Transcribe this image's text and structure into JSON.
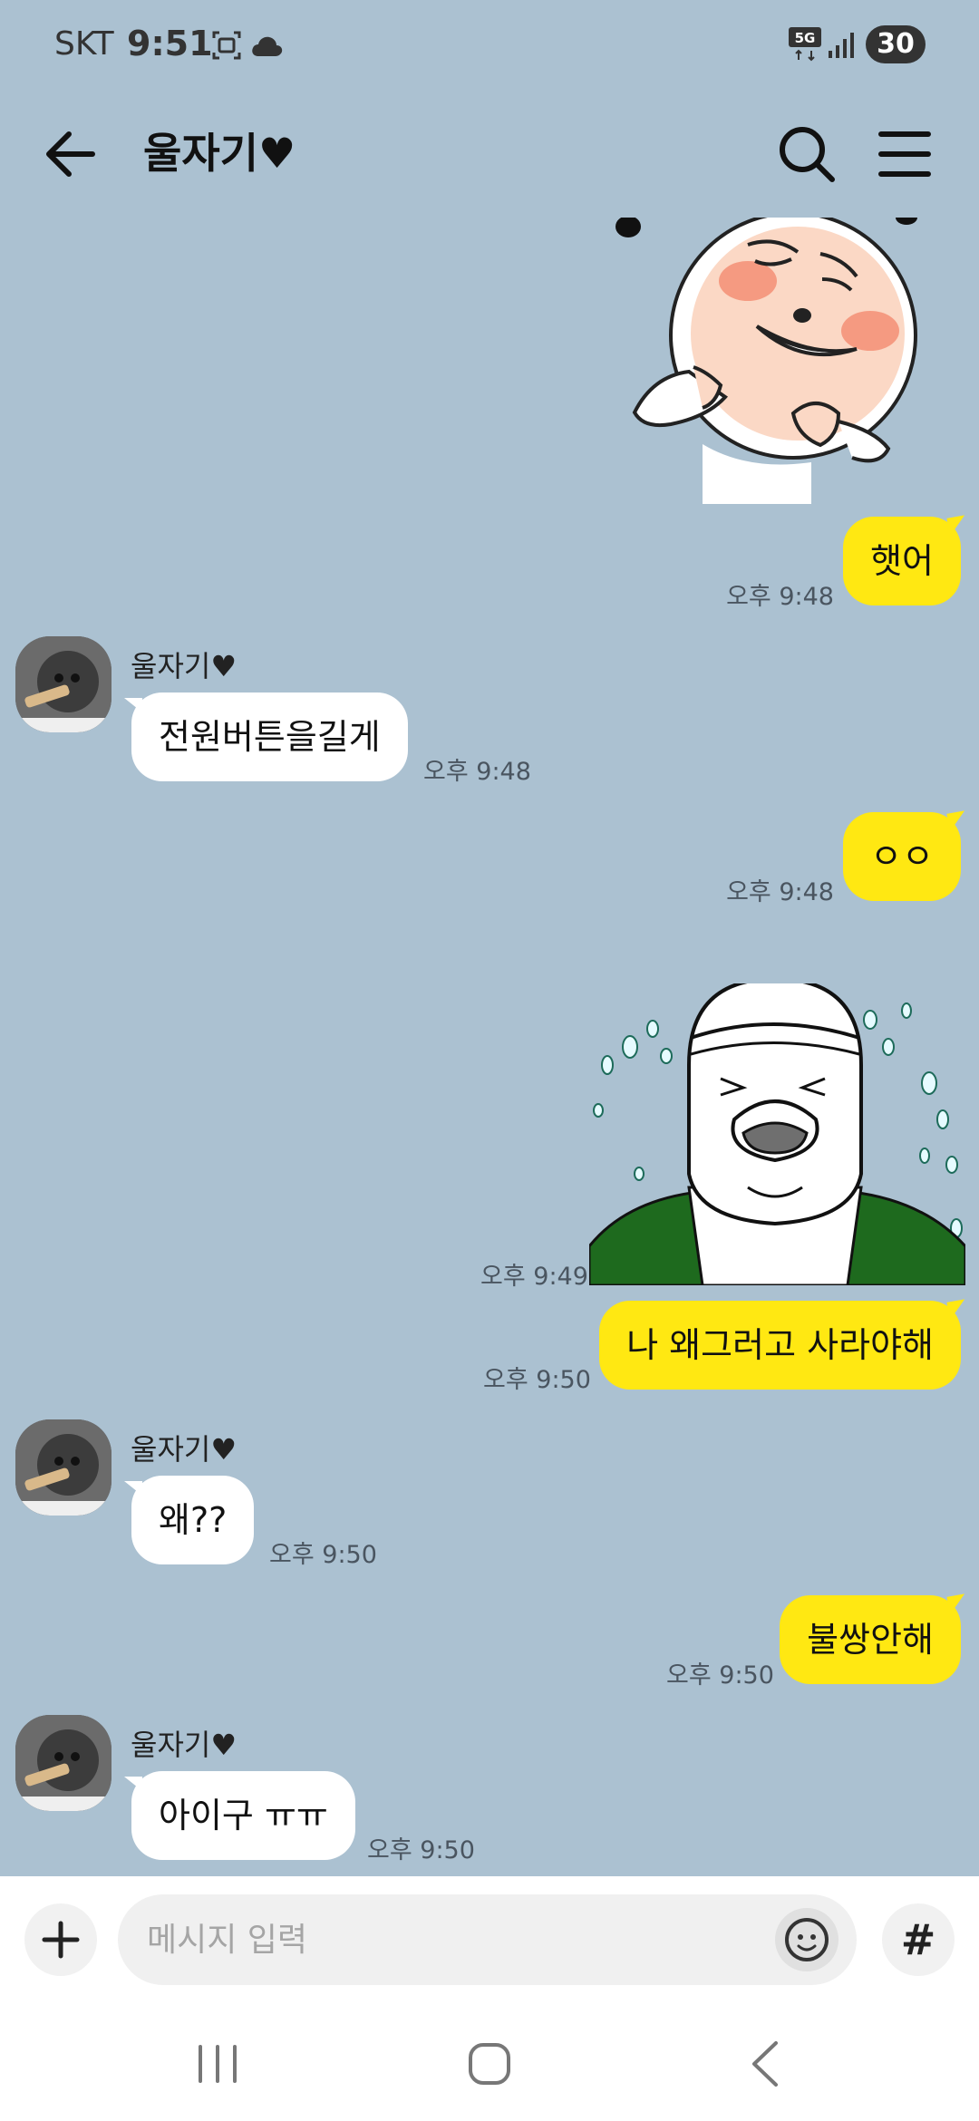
{
  "status_bar": {
    "carrier": "SKT",
    "time": "9:51",
    "network_badge": "5G",
    "battery": "30",
    "icons": [
      "screenshot-icon",
      "cloud-icon",
      "5g-icon",
      "signal-icon",
      "battery-icon"
    ]
  },
  "header": {
    "title": "울자기♥",
    "icons": [
      "back-arrow-icon",
      "search-icon",
      "menu-icon"
    ]
  },
  "messages": [
    {
      "type": "sticker",
      "from": "me",
      "description": "blushing face character sticker"
    },
    {
      "type": "text",
      "from": "me",
      "text": "햇어",
      "time": "오후 9:48"
    },
    {
      "type": "text",
      "from": "other",
      "sender": "울자기♥",
      "text": "전원버튼을길게",
      "time": "오후 9:48"
    },
    {
      "type": "text",
      "from": "me",
      "text": "ㅇㅇ",
      "time": "오후 9:48"
    },
    {
      "type": "sticker",
      "from": "me",
      "description": "crying character sticker",
      "time": "오후 9:49"
    },
    {
      "type": "text",
      "from": "me",
      "text": "나 왜그러고 사라야해",
      "time": "오후 9:50"
    },
    {
      "type": "text",
      "from": "other",
      "sender": "울자기♥",
      "text": "왜??",
      "time": "오후 9:50"
    },
    {
      "type": "text",
      "from": "me",
      "text": "불쌍안해",
      "time": "오후 9:50"
    },
    {
      "type": "text",
      "from": "other",
      "sender": "울자기♥",
      "text": "아이구 ㅠㅠ",
      "time": "오후 9:50"
    }
  ],
  "input": {
    "placeholder": "메시지 입력",
    "value": "",
    "hash_label": "#"
  },
  "nav": {
    "icons": [
      "recent-apps-icon",
      "home-icon",
      "back-icon"
    ]
  },
  "colors": {
    "background": "#abc1d1",
    "my_bubble": "#ffe812",
    "other_bubble": "#ffffff"
  }
}
